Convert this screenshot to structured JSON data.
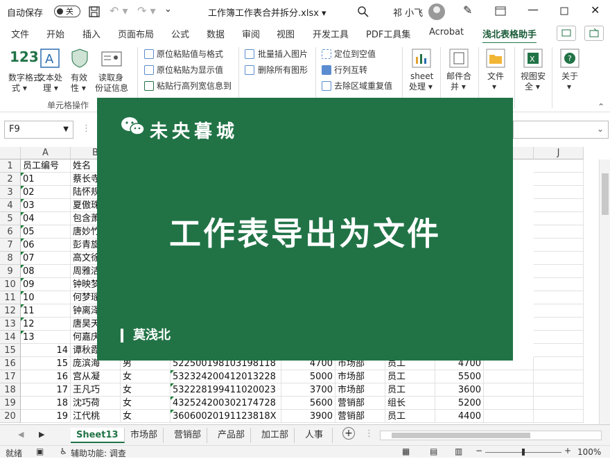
{
  "titlebar": {
    "autosave_label": "自动保存",
    "autosave_state": "关",
    "filename": "工作簿工作表合并拆分.xlsx",
    "user": "祁 小飞"
  },
  "tabs": [
    "文件",
    "开始",
    "插入",
    "页面布局",
    "公式",
    "数据",
    "审阅",
    "视图",
    "开发工具",
    "PDF工具集",
    "Acrobat",
    "浅北表格助手"
  ],
  "active_tab": "浅北表格助手",
  "ribbon": {
    "group1": {
      "btn_numtext": "数字格式",
      "btn_numtext_2": "式 ▾",
      "btn_text": "文本处",
      "btn_text_2": "理 ▾",
      "btn_valid": "有效",
      "btn_valid_2": "性 ▾",
      "btn_idcard": "读取身",
      "btn_idcard_2": "份证信息",
      "group_label": "单元格操作"
    },
    "group2": [
      "原位粘贴值与格式",
      "原位粘贴为显示值",
      "粘贴行高列宽信息到"
    ],
    "group3": [
      "批量插入图片",
      "删除所有图形"
    ],
    "group4": [
      "定位到空值",
      "行列互转",
      "去除区域重复值"
    ],
    "big_buttons": [
      {
        "l1": "sheet",
        "l2": "处理 ▾"
      },
      {
        "l1": "邮件合",
        "l2": "并 ▾"
      },
      {
        "l1": "文件",
        "l2": "▾"
      },
      {
        "l1": "视图安",
        "l2": "全 ▾"
      },
      {
        "l1": "关于",
        "l2": "▾"
      }
    ]
  },
  "namebox": "F9",
  "columns": [
    "A",
    "B",
    "J"
  ],
  "rows": [
    {
      "n": "1",
      "a": "员工编号",
      "b": "姓名"
    },
    {
      "n": "2",
      "a": "01",
      "b": "蔡长寺"
    },
    {
      "n": "3",
      "a": "02",
      "b": "陆怀规"
    },
    {
      "n": "4",
      "a": "03",
      "b": "夏傲珠"
    },
    {
      "n": "5",
      "a": "04",
      "b": "包含萧"
    },
    {
      "n": "6",
      "a": "05",
      "b": "唐妙竹"
    },
    {
      "n": "7",
      "a": "06",
      "b": "彭青旋"
    },
    {
      "n": "8",
      "a": "07",
      "b": "高文徐"
    },
    {
      "n": "9",
      "a": "08",
      "b": "周雅洁"
    },
    {
      "n": "10",
      "a": "09",
      "b": "钟映梦"
    },
    {
      "n": "11",
      "a": "10",
      "b": "何梦瑶"
    },
    {
      "n": "12",
      "a": "11",
      "b": "钟离泽"
    },
    {
      "n": "13",
      "a": "12",
      "b": "唐昊天"
    },
    {
      "n": "14",
      "a": "13",
      "b": "何嘉庆"
    },
    {
      "n": "15",
      "a": "14",
      "b": "谭秋霞"
    }
  ],
  "full_rows": [
    {
      "n": "16",
      "a": "15",
      "b": "庞滨海",
      "c": "男",
      "d": "522500198103198118",
      "e": "4700",
      "f": "市场部",
      "g": "员工",
      "h": "4700"
    },
    {
      "n": "17",
      "a": "16",
      "b": "宫从凝",
      "c": "女",
      "d": "532324200412013228",
      "e": "5000",
      "f": "市场部",
      "g": "员工",
      "h": "5500"
    },
    {
      "n": "18",
      "a": "17",
      "b": "王凡巧",
      "c": "女",
      "d": "532228199411020023",
      "e": "3700",
      "f": "市场部",
      "g": "员工",
      "h": "3600"
    },
    {
      "n": "19",
      "a": "18",
      "b": "沈巧荷",
      "c": "女",
      "d": "432524200302174728",
      "e": "5600",
      "f": "营销部",
      "g": "组长",
      "h": "5200"
    },
    {
      "n": "20",
      "a": "19",
      "b": "江代桃",
      "c": "女",
      "d": "36060020191123818X",
      "e": "3900",
      "f": "营销部",
      "g": "员工",
      "h": "4400"
    }
  ],
  "sheets": [
    "Sheet13",
    "市场部",
    "营销部",
    "产品部",
    "加工部",
    "人事"
  ],
  "active_sheet": "Sheet13",
  "status": {
    "ready": "就绪",
    "accessibility": "辅助功能: 调查",
    "zoom": "100%"
  },
  "overlay": {
    "brand": "未央暮城",
    "headline": "工作表导出为文件",
    "author": "莫浅北"
  },
  "colors": {
    "accent": "#217346",
    "overlay_bg": "#217346"
  }
}
